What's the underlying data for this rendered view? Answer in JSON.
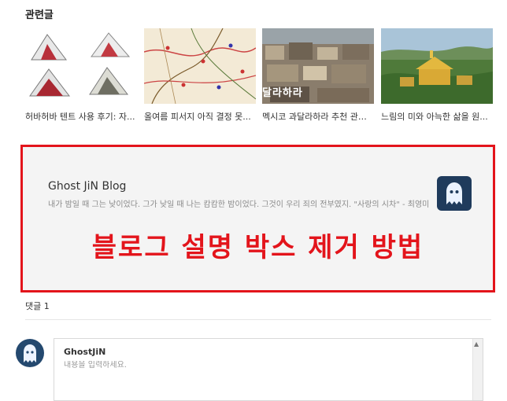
{
  "related": {
    "title": "관련글",
    "posts": [
      {
        "caption": "허바허바 텐트 사용 후기: 자..."
      },
      {
        "caption": "올여름 피서지 아직 결정 못..."
      },
      {
        "caption": "멕시코 과달라하라 추천 관광..."
      },
      {
        "caption": "느림의 미와 아늑한 삶을 원..."
      }
    ],
    "photo_text": "달라하라"
  },
  "blog_box": {
    "title": "Ghost JiN Blog",
    "description": "내가 밤일 때 그는 낮이었다. 그가 낮일 때 나는 캄캄한 밤이었다. 그것이 우리 죄의 전부였지. \"사랑의 시차\" - 최영미",
    "overlay": "블로그 설명 박스 제거 방법",
    "frame_color": "#e3141b"
  },
  "comments": {
    "count_label": "댓글 1",
    "author": "GhostJiN",
    "placeholder": "내용을 입력하세요."
  }
}
